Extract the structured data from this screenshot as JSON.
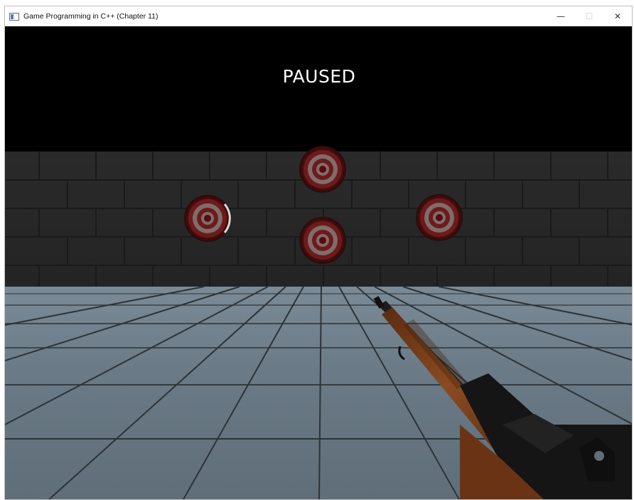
{
  "window": {
    "title": "Game Programming in C++ (Chapter 11)",
    "controls": {
      "minimize_icon": "minimize-icon",
      "maximize_icon": "maximize-icon",
      "close_icon": "close-icon",
      "minimize_glyph": "—",
      "maximize_glyph": "☐",
      "close_glyph": "✕"
    }
  },
  "game": {
    "overlay_text": "PAUSED",
    "targets_count": 4,
    "colors": {
      "sky": "#000000",
      "wall": "#2b2b2b",
      "floor": "#6d7d88",
      "target_ring_dark": "#6a1515",
      "target_ring_light": "#7a6a6a",
      "rifle_wood": "#7a3f1a",
      "rifle_metal": "#161616"
    }
  }
}
